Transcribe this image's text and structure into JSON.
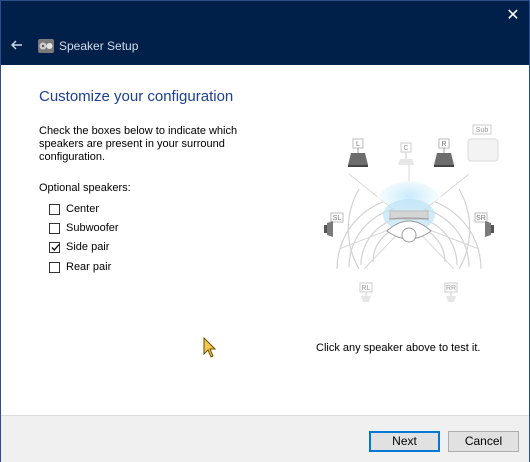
{
  "window": {
    "title": "Speaker Setup",
    "close_glyph": "✕",
    "back_icon": "back-arrow-icon",
    "app_icon": "speaker-setup-icon"
  },
  "page": {
    "heading": "Customize your configuration",
    "instructions": "Check the boxes below to indicate which speakers are present in your surround configuration.",
    "optional_label": "Optional speakers:",
    "hint": "Click any speaker above to test it."
  },
  "speakers": [
    {
      "label": "Center",
      "checked": false
    },
    {
      "label": "Subwoofer",
      "checked": false
    },
    {
      "label": "Side pair",
      "checked": true
    },
    {
      "label": "Rear pair",
      "checked": false
    }
  ],
  "diagram": {
    "labels": {
      "front_left": "L",
      "center": "C",
      "front_right": "R",
      "subwoofer": "Sub",
      "side_left": "SL",
      "side_right": "SR",
      "rear_left": "RL",
      "rear_right": "RR"
    }
  },
  "footer": {
    "next_label": "Next",
    "cancel_label": "Cancel"
  },
  "colors": {
    "titlebar": "#00204a",
    "heading": "#1c3f94",
    "accent": "#0078d7",
    "highlight": "#bfe3f5"
  }
}
